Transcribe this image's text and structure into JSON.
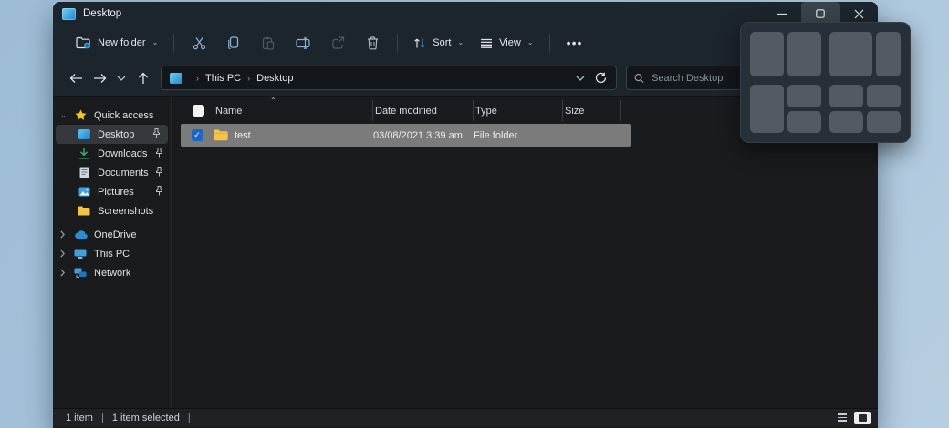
{
  "window": {
    "title": "Desktop"
  },
  "toolbar": {
    "new_folder_label": "New folder",
    "sort_label": "Sort",
    "view_label": "View",
    "more_glyph": "•••",
    "chevron_glyph": "⌄",
    "icons": [
      "new-folder",
      "cut",
      "copy",
      "paste",
      "rename",
      "share",
      "delete",
      "sort",
      "view",
      "see-more"
    ]
  },
  "navbar": {
    "breadcrumb": {
      "separator": "›",
      "root": "This PC",
      "current": "Desktop"
    },
    "search_placeholder": "Search Desktop"
  },
  "sidebar": {
    "quick_access": {
      "label": "Quick access",
      "chevron": "⌄",
      "items": [
        {
          "label": "Desktop",
          "icon": "desktop-icon",
          "pinned": true,
          "selected": true
        },
        {
          "label": "Downloads",
          "icon": "downloads-icon",
          "pinned": true
        },
        {
          "label": "Documents",
          "icon": "document-icon",
          "pinned": true
        },
        {
          "label": "Pictures",
          "icon": "pictures-icon",
          "pinned": true
        },
        {
          "label": "Screenshots",
          "icon": "folder-icon",
          "pinned": false
        }
      ]
    },
    "roots": [
      {
        "label": "OneDrive",
        "icon": "onedrive-cloud-icon",
        "chevron": "›"
      },
      {
        "label": "This PC",
        "icon": "computer-icon",
        "chevron": "›"
      },
      {
        "label": "Network",
        "icon": "network-icon",
        "chevron": "›"
      }
    ]
  },
  "main": {
    "columns": [
      "Name",
      "Date modified",
      "Type",
      "Size"
    ],
    "sort_indicator": "⌃",
    "checkmark": "✓",
    "rows": [
      {
        "name": "test",
        "date_modified": "03/08/2021 3:39 am",
        "type": "File folder",
        "size": "",
        "selected": true
      }
    ]
  },
  "statusbar": {
    "items_count": "1 item",
    "selected_count": "1 item selected",
    "divider": "|"
  },
  "snap_layouts": {
    "groups": [
      "two-equal-columns",
      "wide-left-narrow-right",
      "left-half-right-stacked",
      "four-quadrants"
    ]
  },
  "colors": {
    "chrome": "#1c242c",
    "body": "#1a1b1d",
    "selection_row": "#7b7b7b",
    "checkbox_accent": "#1d66c4",
    "folder_yellow": "#f3c44a",
    "star_gold": "#f8c51c",
    "wallpaper_blue": "#a6c3db"
  }
}
